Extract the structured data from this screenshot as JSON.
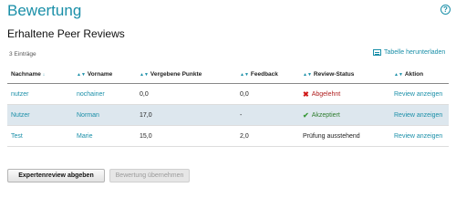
{
  "page": {
    "title": "Bewertung",
    "help_symbol": "?",
    "subtitle": "Erhaltene Peer Reviews",
    "entries_count": "3 Einträge",
    "download_label": "Tabelle herunterladen"
  },
  "table": {
    "headers": {
      "lastname": "Nachname",
      "firstname": "Vorname",
      "points": "Vergebene Punkte",
      "feedback": "Feedback",
      "status": "Review-Status",
      "action": "Aktion"
    },
    "rows": [
      {
        "lastname": "nutzer",
        "firstname": "nochainer",
        "points": "0,0",
        "feedback": "0,0",
        "status": "Abgelehnt",
        "status_type": "rejected",
        "action": "Review anzeigen"
      },
      {
        "lastname": "Nutzer",
        "firstname": "Norman",
        "points": "17,0",
        "feedback": "-",
        "status": "Akzeptiert",
        "status_type": "accepted",
        "action": "Review anzeigen"
      },
      {
        "lastname": "Test",
        "firstname": "Marie",
        "points": "15,0",
        "feedback": "2,0",
        "status": "Prüfung ausstehend",
        "status_type": "pending",
        "action": "Review anzeigen"
      }
    ]
  },
  "buttons": {
    "expert_review": "Expertenreview abgeben",
    "apply_rating": "Bewertung übernehmen"
  },
  "colors": {
    "accent": "#1a8fa8",
    "rejected": "#d01818",
    "accepted": "#3a9a3a",
    "row_alt": "#dde7ee"
  }
}
